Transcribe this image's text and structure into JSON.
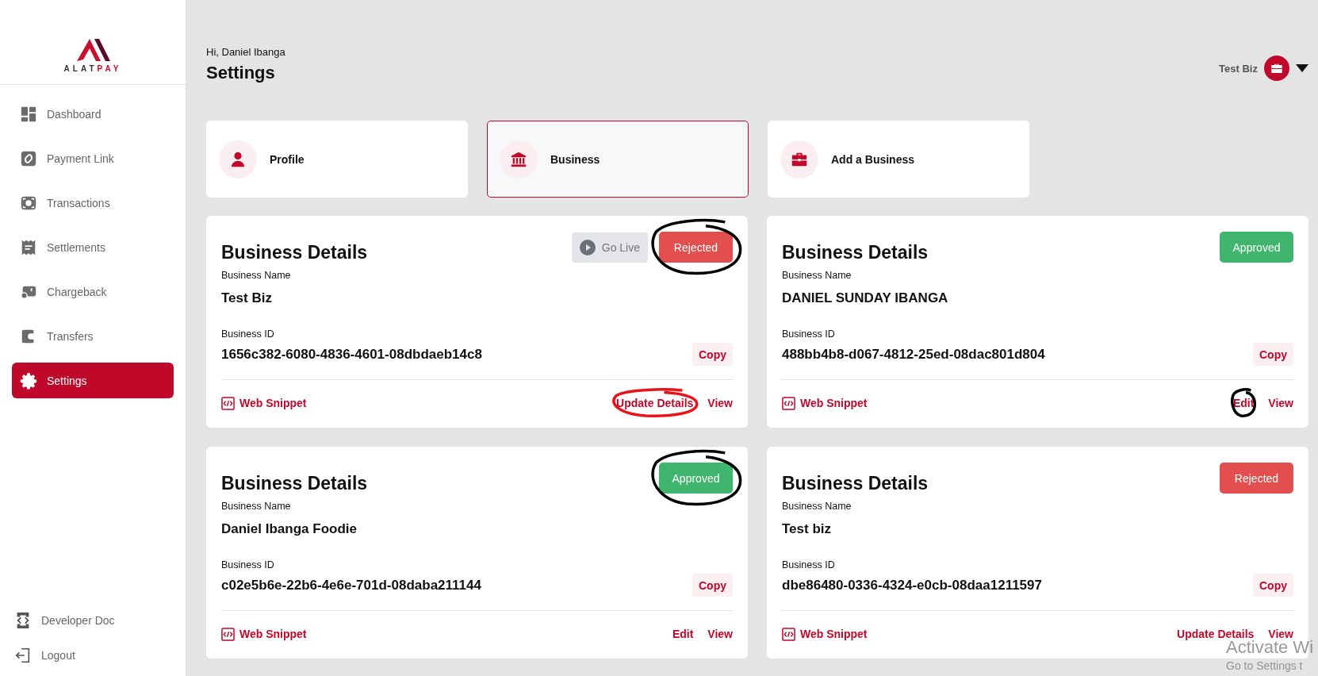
{
  "sidebar": {
    "logo": {
      "text_1": "ALAT",
      "text_2": "PAY"
    },
    "items": [
      {
        "label": "Dashboard",
        "selected": false
      },
      {
        "label": "Payment Link",
        "selected": false
      },
      {
        "label": "Transactions",
        "selected": false
      },
      {
        "label": "Settlements",
        "selected": false
      },
      {
        "label": "Chargeback",
        "selected": false
      },
      {
        "label": "Transfers",
        "selected": false
      },
      {
        "label": "Settings",
        "selected": true
      }
    ],
    "footer_items": [
      {
        "label": "Developer Doc"
      },
      {
        "label": "Logout"
      }
    ]
  },
  "header": {
    "greeting": "Hi, Daniel Ibanga",
    "title": "Settings",
    "business": "Test Biz"
  },
  "tabs": [
    {
      "label": "Profile",
      "selected": false
    },
    {
      "label": "Business",
      "selected": true
    },
    {
      "label": "Add a Business",
      "selected": false
    }
  ],
  "cards": [
    {
      "title": "Business Details",
      "go_live": {
        "label": "Go Live",
        "disabled": true
      },
      "status": {
        "label": "Rejected",
        "kind": "rejected",
        "circled": true,
        "color": "#000000"
      },
      "name_label": "Business Name",
      "name": "Test Biz",
      "id_label": "Business ID",
      "id": "1656c382-6080-4836-4601-08dbdaeb14c8",
      "copy": "Copy",
      "snippet": "Web Snippet",
      "actions": [
        {
          "label": "Update Details",
          "circled": true,
          "color": "#e8141a"
        },
        {
          "label": "View",
          "circled": false
        }
      ]
    },
    {
      "title": "Business Details",
      "status": {
        "label": "Approved",
        "kind": "approved",
        "circled": false
      },
      "name_label": "Business Name",
      "name": "DANIEL SUNDAY IBANGA",
      "id_label": "Business ID",
      "id": "488bb4b8-d067-4812-25ed-08dac801d804",
      "copy": "Copy",
      "snippet": "Web Snippet",
      "actions": [
        {
          "label": "Edit",
          "circled": true,
          "color": "#000000"
        },
        {
          "label": "View",
          "circled": false
        }
      ]
    },
    {
      "title": "Business Details",
      "status": {
        "label": "Approved",
        "kind": "approved",
        "circled": true,
        "color": "#000000"
      },
      "name_label": "Business Name",
      "name": "Daniel Ibanga Foodie",
      "id_label": "Business ID",
      "id": "c02e5b6e-22b6-4e6e-701d-08daba211144",
      "copy": "Copy",
      "snippet": "Web Snippet",
      "actions": [
        {
          "label": "Edit",
          "circled": false
        },
        {
          "label": "View",
          "circled": false
        }
      ]
    },
    {
      "title": "Business Details",
      "status": {
        "label": "Rejected",
        "kind": "rejected",
        "circled": false
      },
      "name_label": "Business Name",
      "name": "Test biz",
      "id_label": "Business ID",
      "id": "dbe86480-0336-4324-e0cb-08daa1211597",
      "copy": "Copy",
      "snippet": "Web Snippet",
      "actions": [
        {
          "label": "Update Details",
          "circled": false
        },
        {
          "label": "View",
          "circled": false
        }
      ]
    }
  ],
  "os_notice": {
    "line_1": "Activate Wi",
    "line_2": "Go to Settings t"
  }
}
